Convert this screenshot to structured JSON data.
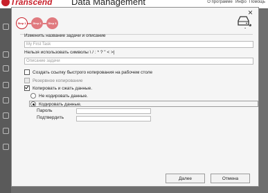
{
  "app": {
    "brand": "Transcend",
    "title": "Data Management",
    "header_links": [
      "О программе",
      "Инфо",
      "Помощь"
    ]
  },
  "dialog": {
    "steps": [
      "Step 1",
      "Step 2",
      "Step 3"
    ],
    "active_step": 1,
    "task_name_label": "Изменить название задачи и описание",
    "task_name_value": "My First Task",
    "invalid_chars_label": "Нельзя использовать символы \\ / : * ? \" < >|",
    "description_placeholder": "Описание задачи",
    "checkboxes": [
      {
        "label": "Создать ссылку быстрого копирования на рабочем столе",
        "checked": false,
        "disabled": false
      },
      {
        "label": "Резервное копирование",
        "checked": false,
        "disabled": true
      },
      {
        "label": "Копировать и сжать данные.",
        "checked": true,
        "disabled": false
      }
    ],
    "radios": [
      {
        "label": "Не кодировать данные.",
        "selected": false
      },
      {
        "label": "Кодировать данные.",
        "selected": true
      }
    ],
    "password_label": "Пароль",
    "confirm_label": "Подтвердить",
    "next_button": "Далее",
    "cancel_button": "Отмена"
  },
  "colors": {
    "accent": "#c8202a",
    "step_inactive": "#e07a7f"
  },
  "icons": [
    "close-icon",
    "hdd-backup-icon"
  ]
}
